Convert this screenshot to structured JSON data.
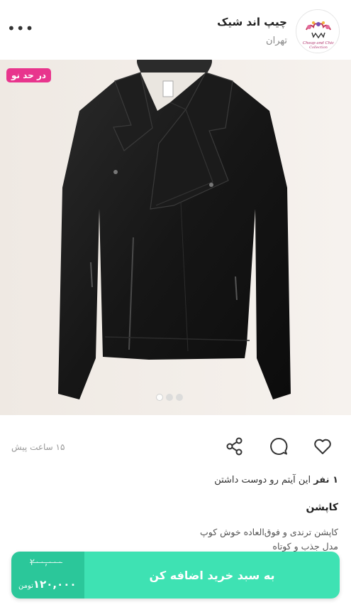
{
  "header": {
    "shop_name": "چیپ اند شیک",
    "city": "تهران",
    "menu_label": "•••",
    "logo_text": "Cheap and Chic Collection"
  },
  "photo": {
    "badge": "در حد نو",
    "slides_count": 3,
    "active_slide": 1
  },
  "actions": {
    "time_ago": "۱۵ ساعت پیش",
    "icons": [
      "heart-icon",
      "comment-icon",
      "share-icon"
    ]
  },
  "likes": {
    "count": "۱ نفر",
    "text": "این آیتم رو دوست داشتن"
  },
  "item": {
    "title": "کاپشن",
    "desc_line1": "کاپشن ترندی و فوق‌العاده خوش کوپ",
    "desc_line2": "مدل جذب و کوتاه"
  },
  "buy": {
    "old_price": "۲۰۰,۰۰۰",
    "new_price": "۱۲۰,۰۰۰",
    "currency": "تومن",
    "button_label": "به سبد خرید اضافه کن"
  },
  "colors": {
    "accent": "#3ee2b3",
    "accent_dark": "#2bc79a",
    "badge": "#e8358d"
  }
}
